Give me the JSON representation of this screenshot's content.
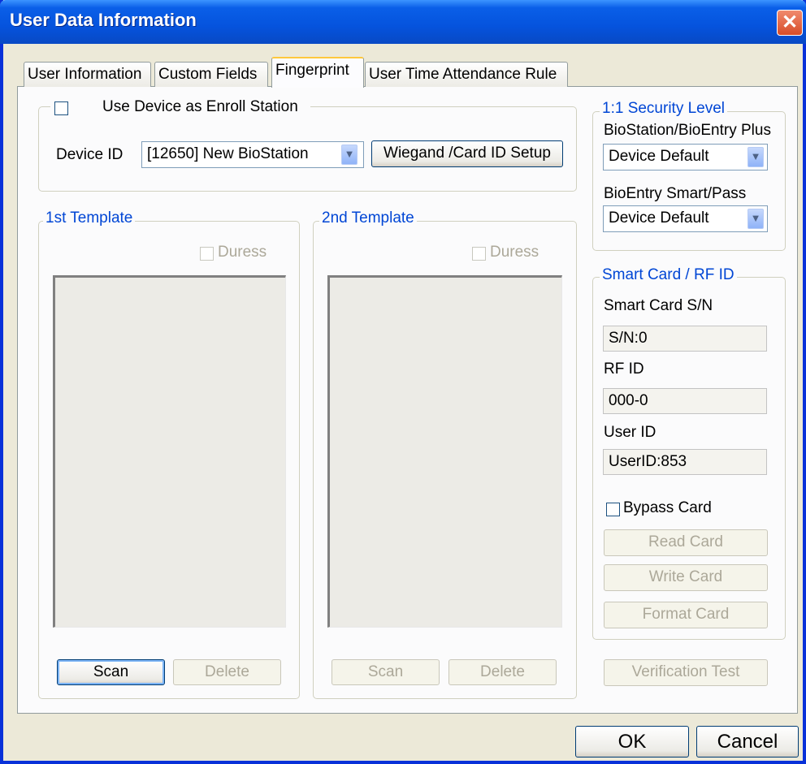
{
  "window": {
    "title": "User Data Information",
    "close_glyph": "✕"
  },
  "tabs": [
    {
      "label": "User Information",
      "active": false
    },
    {
      "label": "Custom Fields",
      "active": false
    },
    {
      "label": "Fingerprint",
      "active": true
    },
    {
      "label": "User Time Attendance Rule",
      "active": false
    }
  ],
  "enroll": {
    "checkbox_label": "Use Device as Enroll Station",
    "checked": false,
    "device_id_label": "Device ID",
    "device_id_value": "[12650] New BioStation",
    "wiegand_button": "Wiegand /Card ID Setup"
  },
  "template1": {
    "legend": "1st Template",
    "duress_label": "Duress",
    "scan_label": "Scan",
    "delete_label": "Delete"
  },
  "template2": {
    "legend": "2nd Template",
    "duress_label": "Duress",
    "scan_label": "Scan",
    "delete_label": "Delete"
  },
  "security_level": {
    "legend": "1:1 Security Level",
    "biostation_label": "BioStation/BioEntry Plus",
    "biostation_value": "Device Default",
    "bioentry_label": "BioEntry Smart/Pass",
    "bioentry_value": "Device Default"
  },
  "smart_card": {
    "legend": "Smart Card / RF ID",
    "sn_label": "Smart Card S/N",
    "sn_value": "S/N:0",
    "rfid_label": "RF ID",
    "rfid_value": "000-0",
    "userid_label": "User ID",
    "userid_value": "UserID:853",
    "bypass_label": "Bypass Card",
    "bypass_checked": false,
    "read_label": "Read Card",
    "write_label": "Write Card",
    "format_label": "Format Card"
  },
  "verification_test_label": "Verification Test",
  "footer": {
    "ok_label": "OK",
    "cancel_label": "Cancel"
  },
  "colors": {
    "title_bar": "#0553dd",
    "legend_text": "#0046d5",
    "dialog_bg": "#ece9d8",
    "close_button": "#d74d29"
  },
  "icons": {
    "dropdown": "chevron-down-icon",
    "close": "close-icon"
  }
}
